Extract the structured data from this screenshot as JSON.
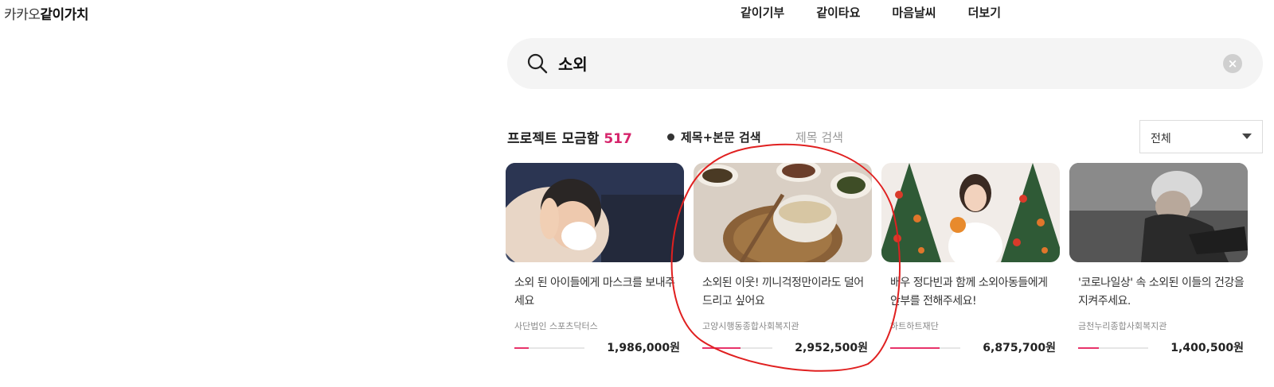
{
  "logo": {
    "light": "카카오",
    "bold": "같이가치"
  },
  "nav": [
    "같이기부",
    "같이타요",
    "마음날씨",
    "더보기"
  ],
  "search": {
    "value": "소외",
    "clear_symbol": "×"
  },
  "results": {
    "label": "프로젝트 모금함",
    "count": "517",
    "option_full": "제목+본문 검색",
    "option_title": "제목 검색",
    "filter_value": "전체"
  },
  "cards": [
    {
      "title": "소외 된 아이들에게 마스크를 보내주세요",
      "org": "사단법인 스포츠닥터스",
      "amount": "1,986,000원",
      "progress": 0.2
    },
    {
      "title": "소외된 이웃! 끼니걱정만이라도 덜어드리고 싶어요",
      "org": "고양시행동종합사회복지관",
      "amount": "2,952,500원",
      "progress": 0.55
    },
    {
      "title": "배우 정다빈과 함께 소외아동들에게 안부를 전해주세요!",
      "org": "하트하트재단",
      "amount": "6,875,700원",
      "progress": 0.7
    },
    {
      "title": "'코로나일상' 속 소외된 이들의 건강을 지켜주세요.",
      "org": "금천누리종합사회복지관",
      "amount": "1,400,500원",
      "progress": 0.3
    }
  ],
  "colors": {
    "accent": "#d6246b",
    "progress": "#e8336a",
    "annotation": "#e02020"
  }
}
